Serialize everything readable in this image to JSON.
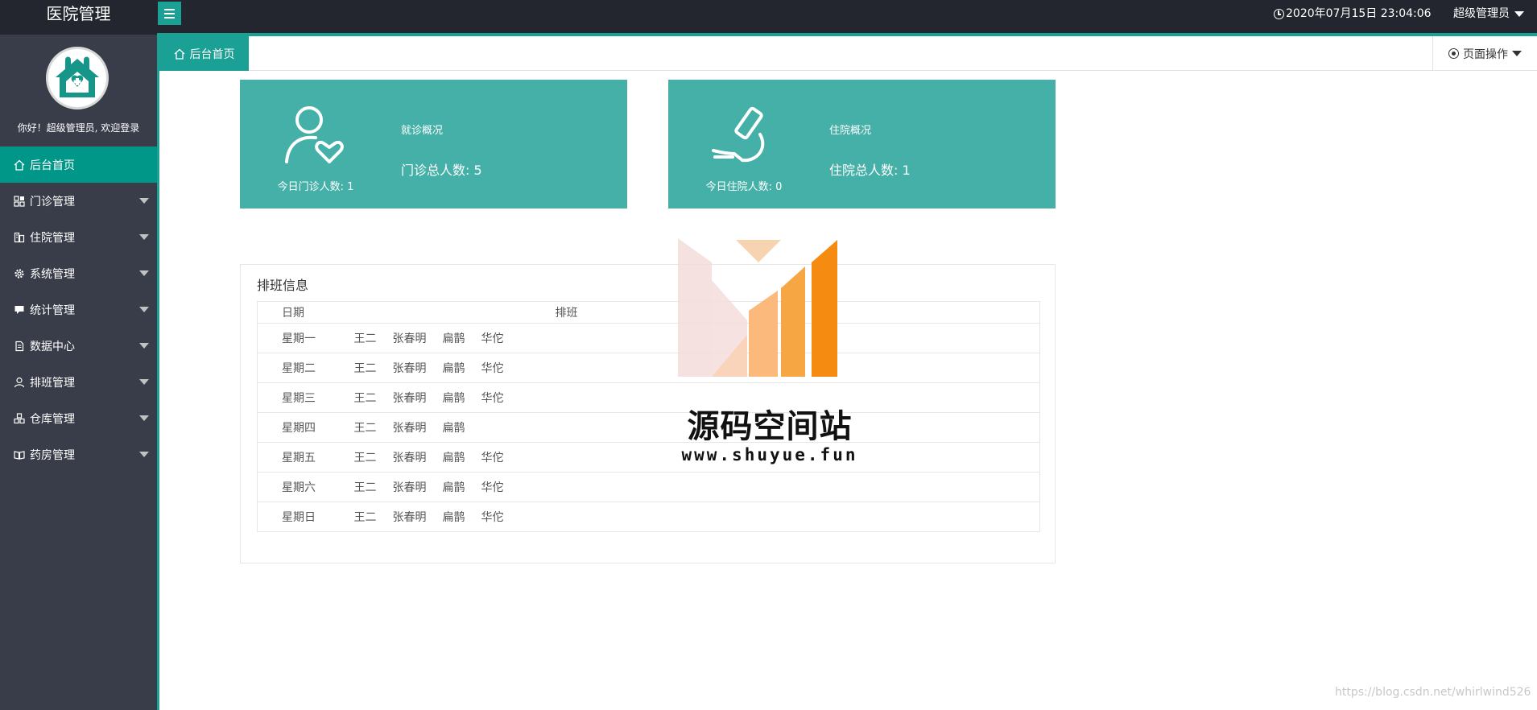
{
  "app": {
    "title": "医院管理"
  },
  "header": {
    "datetime": "2020年07月15日 23:04:06",
    "user_menu": "超级管理员"
  },
  "sidebar": {
    "welcome": "你好！超级管理员, 欢迎登录",
    "items": [
      {
        "label": "后台首页",
        "icon": "home-icon",
        "active": true
      },
      {
        "label": "门诊管理",
        "icon": "grid-icon"
      },
      {
        "label": "住院管理",
        "icon": "building-icon"
      },
      {
        "label": "系统管理",
        "icon": "gear-icon"
      },
      {
        "label": "统计管理",
        "icon": "chat-icon"
      },
      {
        "label": "数据中心",
        "icon": "document-icon"
      },
      {
        "label": "排班管理",
        "icon": "user-icon"
      },
      {
        "label": "仓库管理",
        "icon": "boxes-icon"
      },
      {
        "label": "药房管理",
        "icon": "book-icon"
      }
    ]
  },
  "tabs": {
    "home": "后台首页",
    "page_ops": "页面操作"
  },
  "cards": [
    {
      "title": "就诊概况",
      "total": "门诊总人数: 5",
      "today": "今日门诊人数: 1",
      "icon": "user-heart-icon"
    },
    {
      "title": "住院概况",
      "total": "住院总人数: 1",
      "today": "今日住院人数: 0",
      "icon": "microscope-icon"
    }
  ],
  "schedule": {
    "title": "排班信息",
    "headers": {
      "date": "日期",
      "shift": "排班"
    },
    "rows": [
      {
        "day": "星期一",
        "names": [
          "王二",
          "张春明",
          "扁鹊",
          "华佗"
        ]
      },
      {
        "day": "星期二",
        "names": [
          "王二",
          "张春明",
          "扁鹊",
          "华佗"
        ]
      },
      {
        "day": "星期三",
        "names": [
          "王二",
          "张春明",
          "扁鹊",
          "华佗"
        ]
      },
      {
        "day": "星期四",
        "names": [
          "王二",
          "张春明",
          "扁鹊",
          ""
        ]
      },
      {
        "day": "星期五",
        "names": [
          "王二",
          "张春明",
          "扁鹊",
          "华佗"
        ]
      },
      {
        "day": "星期六",
        "names": [
          "王二",
          "张春明",
          "扁鹊",
          "华佗"
        ]
      },
      {
        "day": "星期日",
        "names": [
          "王二",
          "张春明",
          "扁鹊",
          "华佗"
        ]
      }
    ]
  },
  "watermark": {
    "title": "源码空间站",
    "url": "www.shuyue.fun"
  },
  "footer": {
    "credit": "https://blog.csdn.net/whirlwind526"
  },
  "colors": {
    "accent": "#1aa094",
    "active_nav": "#009688",
    "card": "#44b0a8",
    "sidebar": "#393d49",
    "topbar": "#23262e"
  }
}
